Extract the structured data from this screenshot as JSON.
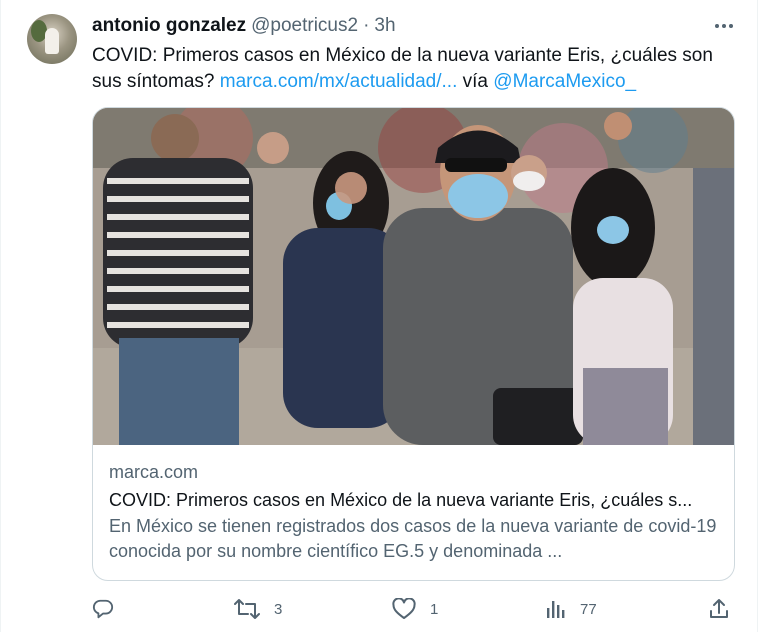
{
  "tweet": {
    "display_name": "antonio gonzalez",
    "handle": "@poetricus2",
    "separator": "·",
    "time": "3h",
    "text_before": "COVID: Primeros casos en México de la nueva variante Eris, ¿cuáles son sus síntomas? ",
    "link": "marca.com/mx/actualidad/...",
    "via": " vía ",
    "mention": "@MarcaMexico_"
  },
  "card": {
    "domain": "marca.com",
    "title": "COVID: Primeros casos en México de la nueva variante Eris, ¿cuáles s...",
    "description": "En México se tienen registrados dos casos de la nueva variante de covid-19 conocida por su nombre científico EG.5 y denominada ..."
  },
  "actions": {
    "reply_count": "",
    "retweet_count": "3",
    "like_count": "1",
    "views_count": "77"
  },
  "icons": [
    "more-icon",
    "reply-icon",
    "retweet-icon",
    "like-icon",
    "views-icon",
    "share-icon"
  ],
  "colors": {
    "link": "#1d9bf0",
    "muted": "#536471",
    "text": "#0f1419"
  }
}
